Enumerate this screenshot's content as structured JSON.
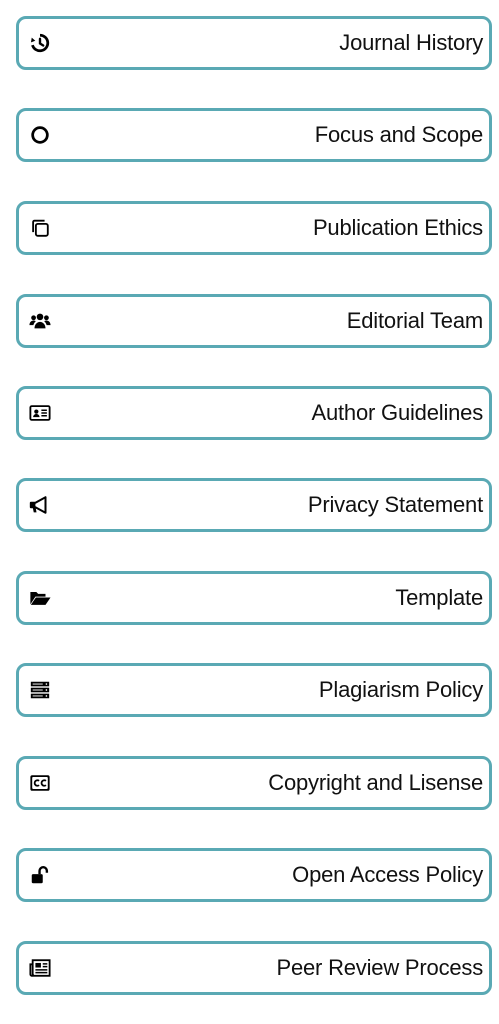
{
  "colors": {
    "border": "#5aa9b4",
    "text": "#111111",
    "icon": "#000000"
  },
  "menu": {
    "items": [
      {
        "label": "Journal History",
        "icon": "history-icon"
      },
      {
        "label": "Focus and Scope",
        "icon": "circle-icon"
      },
      {
        "label": "Publication Ethics",
        "icon": "copy-icon"
      },
      {
        "label": "Editorial Team",
        "icon": "users-icon"
      },
      {
        "label": "Author Guidelines",
        "icon": "id-card-icon"
      },
      {
        "label": "Privacy Statement",
        "icon": "bullhorn-icon"
      },
      {
        "label": "Template",
        "icon": "folder-open-icon"
      },
      {
        "label": "Plagiarism Policy",
        "icon": "server-icon"
      },
      {
        "label": "Copyright and Lisense",
        "icon": "creative-commons-icon"
      },
      {
        "label": "Open Access Policy",
        "icon": "unlock-icon"
      },
      {
        "label": "Peer Review Process",
        "icon": "newspaper-icon"
      }
    ]
  }
}
